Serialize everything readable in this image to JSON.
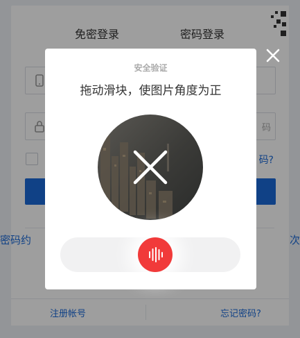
{
  "login": {
    "tabs": [
      "免密登录",
      "密码登录"
    ],
    "password_placeholder_fragment": "码",
    "forgot_inline": "码?",
    "side_left": "密码约",
    "side_right": "次",
    "footer": {
      "register": "注册帐号",
      "forgot": "忘记密码?"
    }
  },
  "captcha": {
    "title": "安全验证",
    "instruction": "拖动滑块，使图片角度为正",
    "slider_progress": 0.52
  },
  "icons": {
    "close": "close-icon",
    "image_overlay": "x-cross-icon",
    "handle": "sound-bars-icon",
    "phone": "phone-icon",
    "lock": "lock-icon",
    "qr": "qr-code-icon"
  },
  "colors": {
    "accent": "#1a6ad9",
    "slider_handle": "#f13a3a",
    "overlay": "rgba(0,0,0,0.38)"
  }
}
